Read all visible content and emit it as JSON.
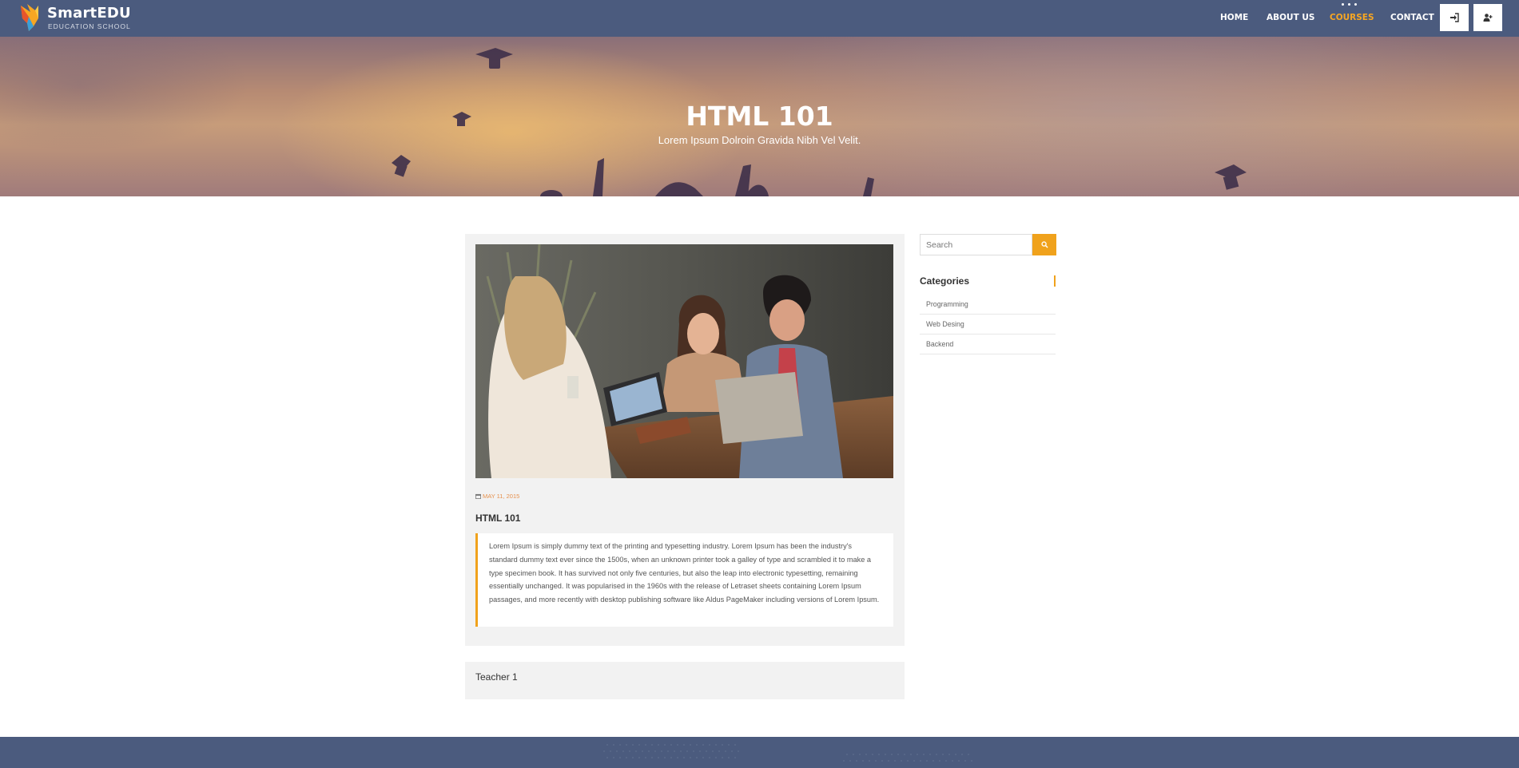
{
  "brand": {
    "name": "SmartEDU",
    "tagline": "EDUCATION SCHOOL",
    "logo_icon": "bird-logo-icon"
  },
  "nav": {
    "items": [
      {
        "label": "HOME",
        "active": false
      },
      {
        "label": "ABOUT US",
        "active": false
      },
      {
        "label": "COURSES",
        "active": true
      },
      {
        "label": "CONTACT",
        "active": false
      }
    ],
    "login_icon": "sign-in-icon",
    "register_icon": "user-plus-icon"
  },
  "hero": {
    "title": "HTML 101",
    "subtitle": "Lorem Ipsum Dolroin Gravida Nibh Vel Velit."
  },
  "course": {
    "image_alt": "Three people at a table with laptops",
    "date": "MAY 11, 2015",
    "title": "HTML 101",
    "description": "Lorem Ipsum is simply dummy text of the printing and typesetting industry. Lorem Ipsum has been the industry's standard dummy text ever since the 1500s, when an unknown printer took a galley of type and scrambled it to make a type specimen book. It has survived not only five centuries, but also the leap into electronic typesetting, remaining essentially unchanged. It was popularised in the 1960s with the release of Letraset sheets containing Lorem Ipsum passages, and more recently with desktop publishing software like Aldus PageMaker including versions of Lorem Ipsum.",
    "teacher": "Teacher 1"
  },
  "sidebar": {
    "search_placeholder": "Search",
    "categories_title": "Categories",
    "categories": [
      "Programming",
      "Web Desing",
      "Backend"
    ]
  },
  "colors": {
    "header_bg": "#4b5b7e",
    "accent": "#f0a21c",
    "date": "#e6914e",
    "card_bg": "#f2f2f2"
  }
}
